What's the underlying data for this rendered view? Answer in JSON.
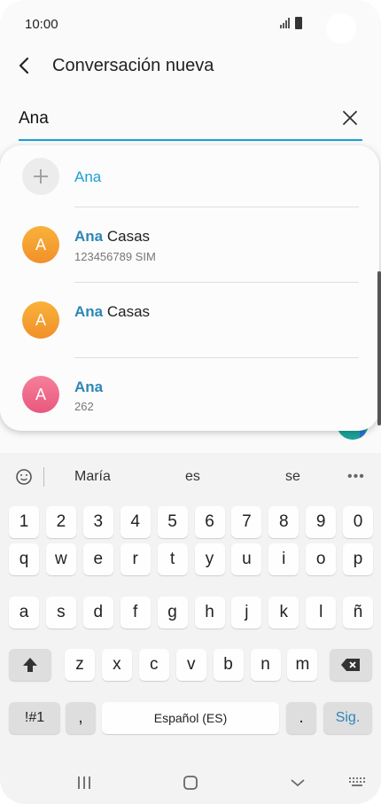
{
  "status": {
    "time": "10:00"
  },
  "header": {
    "title": "Conversación nueva"
  },
  "search": {
    "value": "Ana"
  },
  "results": [
    {
      "avatar_letter": "+",
      "name_highlight": "Ana",
      "name_rest": "",
      "subtitle": ""
    },
    {
      "avatar_letter": "A",
      "name_highlight": "Ana",
      "name_rest": " Casas",
      "subtitle": "123456789  SIM"
    },
    {
      "avatar_letter": "A",
      "name_highlight": "Ana",
      "name_rest": " Casas",
      "subtitle": ""
    },
    {
      "avatar_letter": "A",
      "name_highlight": "Ana",
      "name_rest": "",
      "subtitle": "262"
    }
  ],
  "keyboard": {
    "suggestions": [
      "María",
      "es",
      "se"
    ],
    "row_numbers": [
      "1",
      "2",
      "3",
      "4",
      "5",
      "6",
      "7",
      "8",
      "9",
      "0"
    ],
    "row_q": [
      "q",
      "w",
      "e",
      "r",
      "t",
      "y",
      "u",
      "i",
      "o",
      "p"
    ],
    "row_a": [
      "a",
      "s",
      "d",
      "f",
      "g",
      "h",
      "j",
      "k",
      "l",
      "ñ"
    ],
    "row_z": [
      "z",
      "x",
      "c",
      "v",
      "b",
      "n",
      "m"
    ],
    "symbols_label": "!#1",
    "comma_label": ",",
    "space_label": "Español (ES)",
    "period_label": ".",
    "next_label": "Sig."
  },
  "colors": {
    "accent": "#1c9fd5",
    "highlight": "#2d86b7",
    "avatar_orange": "#f39a2c",
    "avatar_pink": "#ee6a8a"
  }
}
